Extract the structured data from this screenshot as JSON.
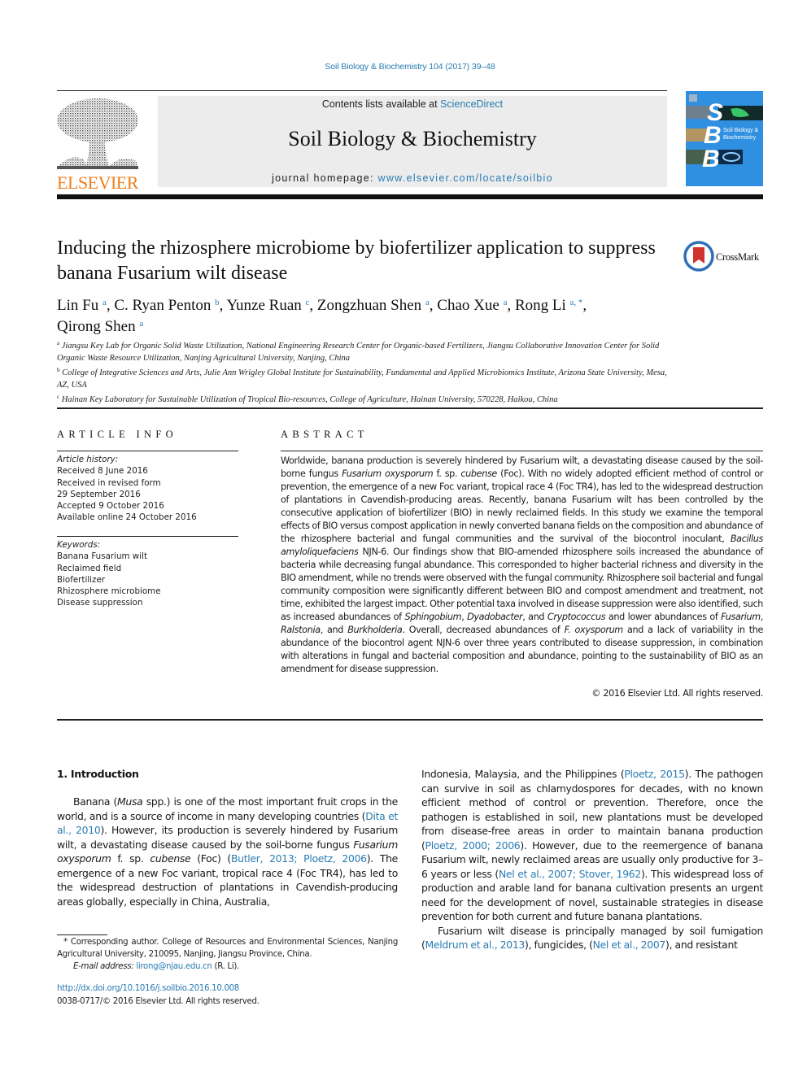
{
  "header": {
    "journal_ref": "Soil Biology & Biochemistry 104 (2017) 39–48",
    "contents_prefix": "Contents lists available at ",
    "contents_link": "ScienceDirect",
    "journal_title": "Soil Biology & Biochemistry",
    "homepage_prefix": "journal homepage: ",
    "homepage_link": "www.elsevier.com/locate/soilbio",
    "publisher_logo_text": "ELSEVIER",
    "cover": {
      "letters": [
        "S",
        "B",
        "B"
      ],
      "title_line1": "Soil Biology &",
      "title_line2": "Biochemistry"
    },
    "colors": {
      "link": "#2a7cb3",
      "elsevier_orange": "#f07d1a",
      "cover_blue": "#2f8fe0",
      "banner_gray": "#ececec"
    }
  },
  "article": {
    "title": "Inducing the rhizosphere microbiome by biofertilizer application to suppress banana Fusarium wilt disease",
    "crossmark_label": "CrossMark",
    "authors": [
      {
        "name": "Lin Fu",
        "sup": "a"
      },
      {
        "name": "C. Ryan Penton",
        "sup": "b"
      },
      {
        "name": "Yunze Ruan",
        "sup": "c"
      },
      {
        "name": "Zongzhuan Shen",
        "sup": "a"
      },
      {
        "name": "Chao Xue",
        "sup": "a"
      },
      {
        "name": "Rong Li",
        "sup": "a, *"
      },
      {
        "name": "Qirong Shen",
        "sup": "a"
      }
    ],
    "affiliations": [
      {
        "sup": "a",
        "text": "Jiangsu Key Lab for Organic Solid Waste Utilization, National Engineering Research Center for Organic-based Fertilizers, Jiangsu Collaborative Innovation Center for Solid Organic Waste Resource Utilization, Nanjing Agricultural University, Nanjing, China"
      },
      {
        "sup": "b",
        "text": "College of Integrative Sciences and Arts, Julie Ann Wrigley Global Institute for Sustainability, Fundamental and Applied Microbiomics Institute, Arizona State University, Mesa, AZ, USA"
      },
      {
        "sup": "c",
        "text": "Hainan Key Laboratory for Sustainable Utilization of Tropical Bio-resources, College of Agriculture, Hainan University, 570228, Haikou, China"
      }
    ]
  },
  "article_info": {
    "heading": "ARTICLE INFO",
    "history_label": "Article history:",
    "history": [
      "Received 8 June 2016",
      "Received in revised form",
      "29 September 2016",
      "Accepted 9 October 2016",
      "Available online 24 October 2016"
    ],
    "keywords_label": "Keywords:",
    "keywords": [
      "Banana Fusarium wilt",
      "Reclaimed field",
      "Biofertilizer",
      "Rhizosphere microbiome",
      "Disease suppression"
    ]
  },
  "abstract": {
    "heading": "ABSTRACT",
    "segments": [
      {
        "t": "Worldwide, banana production is severely hindered by Fusarium wilt, a devastating disease caused by the soil-borne fungus "
      },
      {
        "t": "Fusarium oxysporum",
        "i": true
      },
      {
        "t": " f. sp. "
      },
      {
        "t": "cubense",
        "i": true
      },
      {
        "t": " (Foc). With no widely adopted efficient method of control or prevention, the emergence of a new Foc variant, tropical race 4 (Foc TR4), has led to the widespread destruction of plantations in Cavendish-producing areas. Recently, banana Fusarium wilt has been controlled by the consecutive application of biofertilizer (BIO) in newly reclaimed fields. In this study we examine the temporal effects of BIO versus compost application in newly converted banana fields on the composition and abundance of the rhizosphere bacterial and fungal communities and the survival of the biocontrol inoculant, "
      },
      {
        "t": "Bacillus amyloliquefaciens",
        "i": true
      },
      {
        "t": " NJN-6. Our findings show that BIO-amended rhizosphere soils increased the abundance of bacteria while decreasing fungal abundance. This corresponded to higher bacterial richness and diversity in the BIO amendment, while no trends were observed with the fungal community. Rhizosphere soil bacterial and fungal community composi­tion were significantly different between BIO and compost amendment and treatment, not time, exhibited the largest impact. Other potential taxa involved in disease suppression were also identified, such as increased abundances of "
      },
      {
        "t": "Sphingobium",
        "i": true
      },
      {
        "t": ", "
      },
      {
        "t": "Dyadobacter",
        "i": true
      },
      {
        "t": ", and "
      },
      {
        "t": "Cryptococcus",
        "i": true
      },
      {
        "t": " and lower abundances of "
      },
      {
        "t": "Fusarium",
        "i": true
      },
      {
        "t": ", "
      },
      {
        "t": "Ralstonia",
        "i": true
      },
      {
        "t": ", and "
      },
      {
        "t": "Burkholderia",
        "i": true
      },
      {
        "t": ". Overall, decreased abundances of "
      },
      {
        "t": "F. oxysporum",
        "i": true
      },
      {
        "t": " and a lack of variability in the abundance of the biocontrol agent NJN-6 over three years contributed to disease suppression, in combination with alterations in fungal and bacterial composition and abundance, pointing to the sustainability of BIO as an amendment for disease suppression."
      }
    ],
    "copyright": "© 2016 Elsevier Ltd. All rights reserved."
  },
  "body": {
    "intro_heading": "1.  Introduction",
    "left_paragraph": [
      {
        "t": "Banana ("
      },
      {
        "t": "Musa",
        "i": true
      },
      {
        "t": " spp.) is one of the most important fruit crops in the world, and is a source of income in many developing countries ("
      },
      {
        "t": "Dita et al., 2010",
        "c": true
      },
      {
        "t": "). However, its production is severely hindered by Fusarium wilt, a devastating disease caused by the soil-borne fun­gus "
      },
      {
        "t": "Fusarium oxysporum",
        "i": true
      },
      {
        "t": " f. sp. "
      },
      {
        "t": "cubense",
        "i": true
      },
      {
        "t": " (Foc) ("
      },
      {
        "t": "Butler, 2013; Ploetz, 2006",
        "c": true
      },
      {
        "t": "). The emergence of a new Foc variant, tropical race 4 (Foc TR4), has led to the widespread destruction of plantations in Cavendish-producing areas globally, especially in China, Australia,"
      }
    ],
    "right_paragraph1": [
      {
        "t": "Indonesia, Malaysia, and the Philippines ("
      },
      {
        "t": "Ploetz, 2015",
        "c": true
      },
      {
        "t": "). The path­ogen can survive in soil as chlamydospores for decades, with no known efficient method of control or prevention. Therefore, once the pathogen is established in soil, new plantations must be developed from disease-free areas in order to maintain banana production ("
      },
      {
        "t": "Ploetz, 2000; 2006",
        "c": true
      },
      {
        "t": "). However, due to the re­emergence of banana Fusarium wilt, newly reclaimed areas are usually only productive for 3–6 years or less ("
      },
      {
        "t": "Nel et al., 2007; Stover, 1962",
        "c": true
      },
      {
        "t": "). This widespread loss of production and arable land for banana cultivation presents an urgent need for the development of novel, sustainable strategies in disease prevention for both cur­rent and future banana plantations."
      }
    ],
    "right_paragraph2": [
      {
        "t": "Fusarium wilt disease is principally managed by soil fumigation ("
      },
      {
        "t": "Meldrum et al., 2013",
        "c": true
      },
      {
        "t": "), fungicides, ("
      },
      {
        "t": "Nel et al., 2007",
        "c": true
      },
      {
        "t": "), and resistant"
      }
    ]
  },
  "footnote": {
    "corresponding": "* Corresponding author. College of Resources and Environmental Sciences, Nanjing Agricultural University, 210095, Nanjing, Jiangsu Province, China.",
    "email_label": "E-mail address: ",
    "email": "lirong@njau.edu.cn",
    "email_suffix": " (R. Li).",
    "doi": "http://dx.doi.org/10.1016/j.soilbio.2016.10.008",
    "issn": "0038-0717/© 2016 Elsevier Ltd. All rights reserved."
  }
}
